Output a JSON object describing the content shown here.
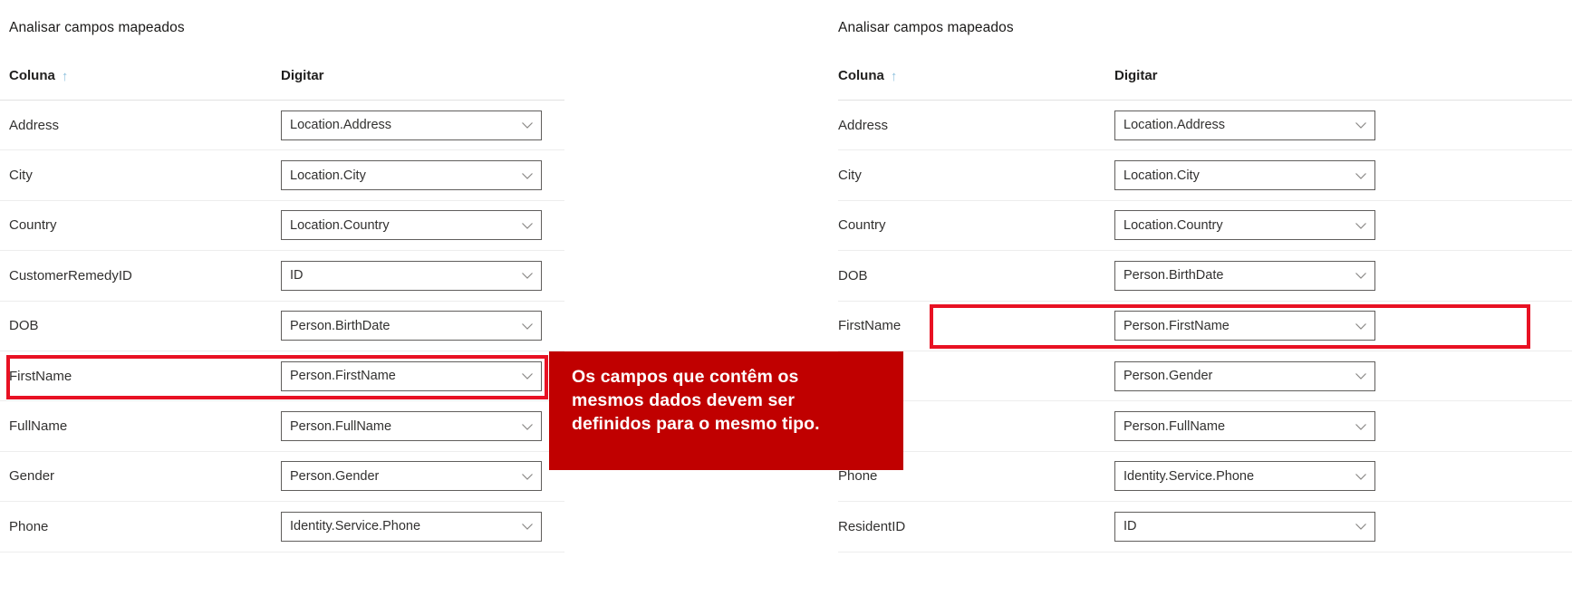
{
  "panels": [
    {
      "id": "left",
      "title": "Analisar campos mapeados",
      "headers": {
        "column": "Coluna",
        "sort_icon": "↑",
        "type": "Digitar"
      },
      "rows": [
        {
          "column": "Address",
          "type": "Location.Address"
        },
        {
          "column": "City",
          "type": "Location.City"
        },
        {
          "column": "Country",
          "type": "Location.Country"
        },
        {
          "column": "CustomerRemedyID",
          "type": "ID"
        },
        {
          "column": "DOB",
          "type": "Person.BirthDate"
        },
        {
          "column": "FirstName",
          "type": "Person.FirstName"
        },
        {
          "column": "FullName",
          "type": "Person.FullName"
        },
        {
          "column": "Gender",
          "type": "Person.Gender"
        },
        {
          "column": "Phone",
          "type": "Identity.Service.Phone"
        }
      ]
    },
    {
      "id": "right",
      "title": "Analisar campos mapeados",
      "headers": {
        "column": "Coluna",
        "sort_icon": "↑",
        "type": "Digitar"
      },
      "rows": [
        {
          "column": "Address",
          "type": "Location.Address"
        },
        {
          "column": "City",
          "type": "Location.City"
        },
        {
          "column": "Country",
          "type": "Location.Country"
        },
        {
          "column": "DOB",
          "type": "Person.BirthDate"
        },
        {
          "column": "FirstName",
          "type": "Person.FirstName"
        },
        {
          "column": "",
          "type": "Person.Gender"
        },
        {
          "column": "",
          "type": "Person.FullName"
        },
        {
          "column": "Phone",
          "type": "Identity.Service.Phone"
        },
        {
          "column": "ResidentID",
          "type": "ID"
        }
      ]
    }
  ],
  "callout": {
    "line1": "Os campos que contêm os",
    "line2": "mesmos dados devem ser",
    "line3": "definidos para o mesmo tipo.",
    "background_color": "#c00000",
    "text_color": "#ffffff"
  },
  "highlights": {
    "color": "#e81123",
    "left_row_label": "FirstName",
    "right_row_label": "FirstName"
  }
}
